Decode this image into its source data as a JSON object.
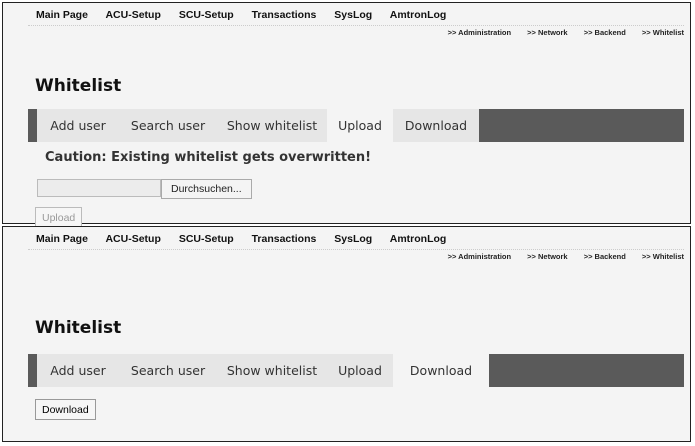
{
  "nav": [
    "Main Page",
    "ACU-Setup",
    "SCU-Setup",
    "Transactions",
    "SysLog",
    "AmtronLog"
  ],
  "breadcrumb": [
    ">> Administration",
    ">> Network",
    ">> Backend",
    ">> Whitelist"
  ],
  "title": "Whitelist",
  "tabs": [
    "Add user",
    "Search user",
    "Show whitelist",
    "Upload",
    "Download"
  ],
  "upload_panel": {
    "active_tab": "Upload",
    "caution": "Caution: Existing whitelist gets overwritten!",
    "file_value": "",
    "browse_label": "Durchsuchen...",
    "upload_button": "Upload"
  },
  "download_panel": {
    "active_tab": "Download",
    "download_button": "Download"
  }
}
